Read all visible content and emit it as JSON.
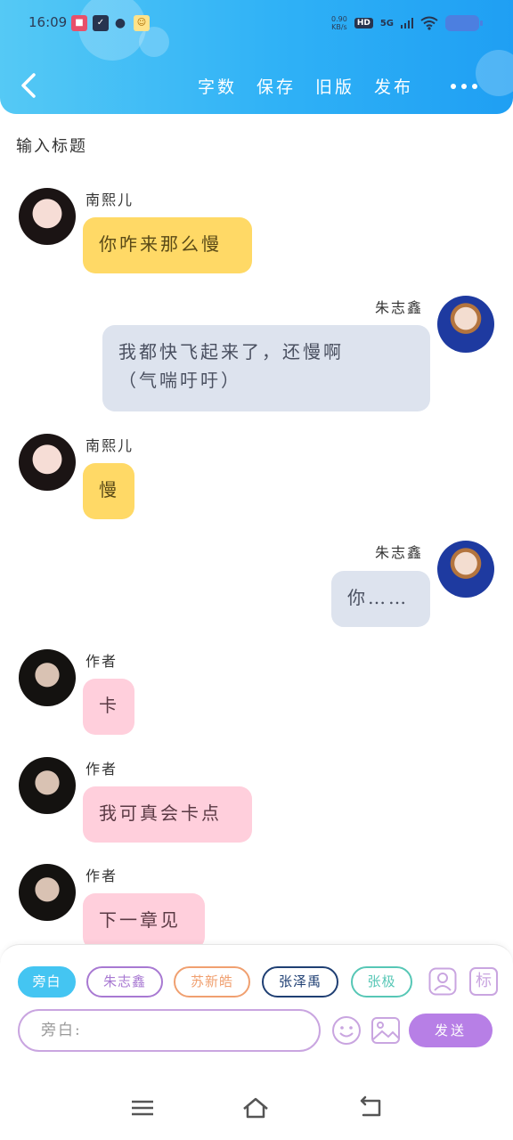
{
  "statusbar": {
    "time": "16:09",
    "net_speed_value": "0.90",
    "net_speed_unit": "KB/s",
    "hd_label": "HD",
    "network_label": "5G"
  },
  "header": {
    "menu": [
      "字数",
      "保存",
      "旧版",
      "发布"
    ]
  },
  "title_placeholder": "输入标题",
  "messages": [
    {
      "name": "南熙儿",
      "text": "你咋来那么慢",
      "side": "left",
      "color": "yellow"
    },
    {
      "name": "朱志鑫",
      "text_line1": "我都快飞起来了，还慢啊",
      "text_line2": "（气喘吁吁）",
      "side": "right",
      "color": "gray"
    },
    {
      "name": "南熙儿",
      "text": "慢",
      "side": "left",
      "color": "yellow"
    },
    {
      "name": "朱志鑫",
      "text": "你……",
      "side": "right",
      "color": "gray"
    },
    {
      "name": "作者",
      "text": "卡",
      "side": "left",
      "color": "pink"
    },
    {
      "name": "作者",
      "text": "我可真会卡点",
      "side": "left",
      "color": "pink"
    },
    {
      "name": "作者",
      "text": "下一章见",
      "side": "left",
      "color": "pink"
    }
  ],
  "characters": [
    {
      "label": "旁白",
      "color": "#44c5f2",
      "active": true
    },
    {
      "label": "朱志鑫",
      "color": "#a879d2",
      "active": false
    },
    {
      "label": "苏新皓",
      "color": "#f0a070",
      "active": false
    },
    {
      "label": "张泽禹",
      "color": "#1f3f73",
      "active": false
    },
    {
      "label": "张极",
      "color": "#57c7b6",
      "active": false
    }
  ],
  "tool_icons": [
    "add-character-icon",
    "tag-icon",
    "emoji-icon",
    "image-icon"
  ],
  "tag_label": "标",
  "input": {
    "placeholder": "旁白:"
  },
  "send_label": "发送",
  "nav": [
    "menu-icon",
    "home-icon",
    "back-icon"
  ],
  "colors": {
    "header_start": "#55c9f5",
    "header_end": "#1f9ff3",
    "yellow_bubble": "#ffd966",
    "gray_bubble": "#dde3ee",
    "pink_bubble": "#ffcfdc",
    "send": "#b77fe6"
  }
}
